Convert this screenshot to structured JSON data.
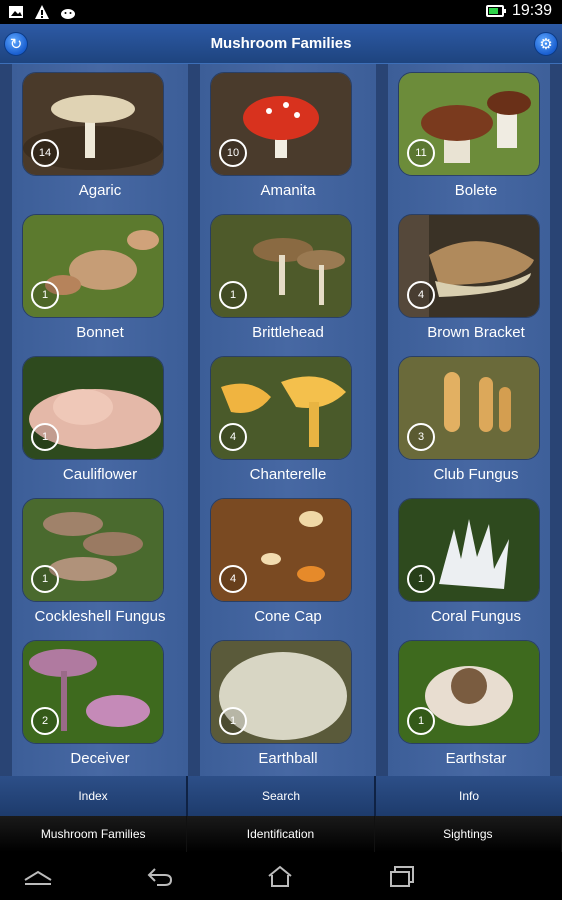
{
  "status_bar": {
    "time": "19:39",
    "icons": [
      "image-icon",
      "warning-icon",
      "android-icon",
      "battery-icon"
    ]
  },
  "header": {
    "title": "Mushroom Families",
    "refresh_icon": "refresh-icon",
    "settings_icon": "gear-icon"
  },
  "families": [
    {
      "name": "Agaric",
      "count": "14"
    },
    {
      "name": "Amanita",
      "count": "10"
    },
    {
      "name": "Bolete",
      "count": "11"
    },
    {
      "name": "Bonnet",
      "count": "1"
    },
    {
      "name": "Brittlehead",
      "count": "1"
    },
    {
      "name": "Brown Bracket",
      "count": "4"
    },
    {
      "name": "Cauliflower",
      "count": "1"
    },
    {
      "name": "Chanterelle",
      "count": "4"
    },
    {
      "name": "Club Fungus",
      "count": "3"
    },
    {
      "name": "Cockleshell Fungus",
      "count": "1"
    },
    {
      "name": "Cone Cap",
      "count": "4"
    },
    {
      "name": "Coral Fungus",
      "count": "1"
    },
    {
      "name": "Deceiver",
      "count": "2"
    },
    {
      "name": "Earthball",
      "count": "1"
    },
    {
      "name": "Earthstar",
      "count": "1"
    }
  ],
  "tabs_primary": [
    "Index",
    "Search",
    "Info"
  ],
  "tabs_secondary": [
    "Mushroom Families",
    "Identification",
    "Sightings"
  ],
  "nav": [
    "recent-apps-icon",
    "back-icon",
    "home-icon",
    "overview-icon"
  ],
  "colors": {
    "header_top": "#2d5aa6",
    "grid_bg": "#3f5f96",
    "tab_bg": "#1d3b6c",
    "battery_green": "#2fd34a"
  }
}
